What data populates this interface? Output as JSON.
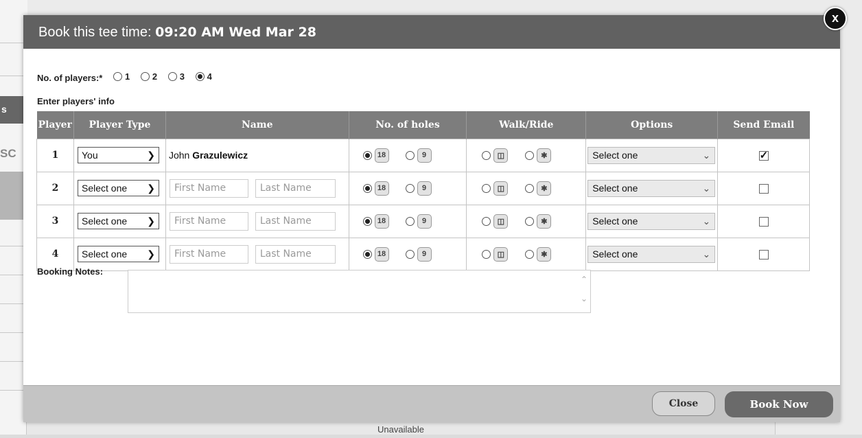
{
  "modal": {
    "title_prefix": "Book this tee time:",
    "title_time": "09:20 AM Wed Mar 28",
    "close_x": "x"
  },
  "players_count": {
    "label": "No. of players:*",
    "options": [
      "1",
      "2",
      "3",
      "4"
    ],
    "selected": "4"
  },
  "enter_info_label": "Enter players' info",
  "table": {
    "headers": [
      "Player",
      "Player Type",
      "Name",
      "No. of holes",
      "Walk/Ride",
      "Options",
      "Send Email"
    ],
    "holes_options": [
      "18",
      "9"
    ],
    "first_name_placeholder": "First Name",
    "last_name_placeholder": "Last Name",
    "rows": [
      {
        "num": "1",
        "type": "You",
        "first": "John",
        "last": "Grazulewicz",
        "option": "Select one",
        "email": true
      },
      {
        "num": "2",
        "type": "Select one",
        "option": "Select one",
        "email": false
      },
      {
        "num": "3",
        "type": "Select one",
        "option": "Select one",
        "email": false
      },
      {
        "num": "4",
        "type": "Select one",
        "option": "Select one",
        "email": false
      }
    ]
  },
  "notes": {
    "label": "Booking Notes:"
  },
  "footer": {
    "close_label": "Close",
    "book_label": "Book Now"
  },
  "background": {
    "unavailable": "Unavailable",
    "frag1": "s",
    "frag2": "SC"
  }
}
